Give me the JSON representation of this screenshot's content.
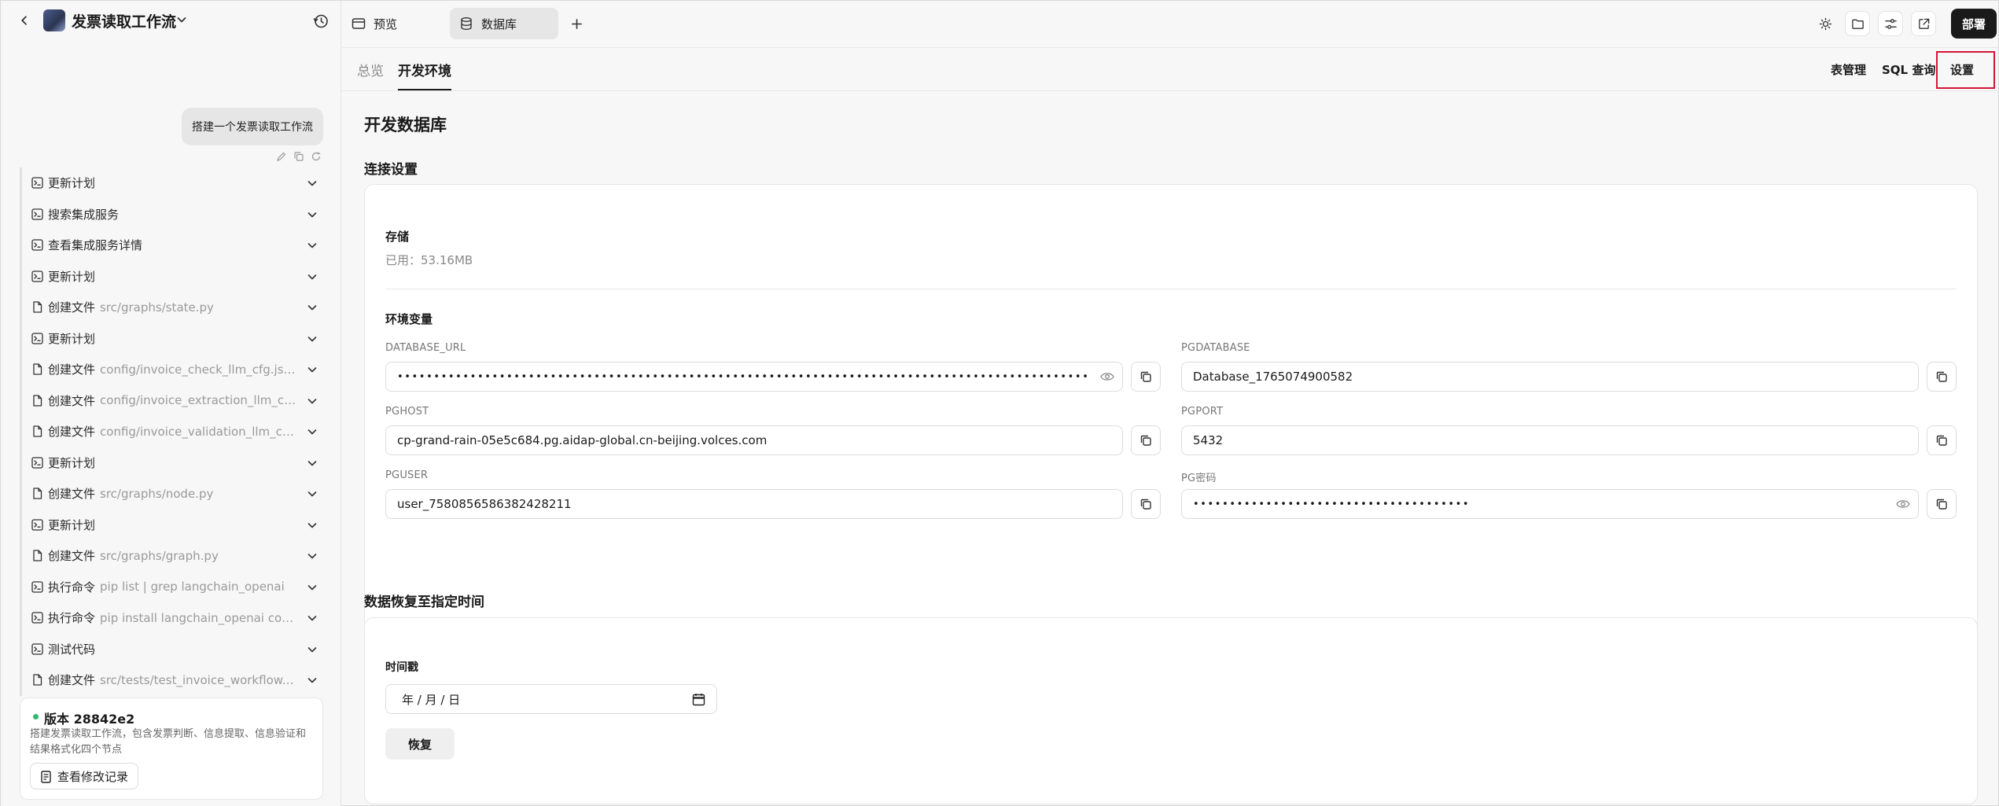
{
  "app": {
    "title": "发票读取工作流"
  },
  "chat": {
    "user_message": "搭建一个发票读取工作流",
    "steps": [
      {
        "label": "更新计划",
        "detail": "",
        "icon": "terminal-icon"
      },
      {
        "label": "搜索集成服务",
        "detail": "",
        "icon": "terminal-icon"
      },
      {
        "label": "查看集成服务详情",
        "detail": "",
        "icon": "terminal-icon"
      },
      {
        "label": "更新计划",
        "detail": "",
        "icon": "terminal-icon"
      },
      {
        "label": "创建文件",
        "detail": "src/graphs/state.py",
        "icon": "file-icon"
      },
      {
        "label": "更新计划",
        "detail": "",
        "icon": "terminal-icon"
      },
      {
        "label": "创建文件",
        "detail": "config/invoice_check_llm_cfg.json",
        "icon": "file-icon"
      },
      {
        "label": "创建文件",
        "detail": "config/invoice_extraction_llm_cf...",
        "icon": "file-icon"
      },
      {
        "label": "创建文件",
        "detail": "config/invoice_validation_llm_cfg...",
        "icon": "file-icon"
      },
      {
        "label": "更新计划",
        "detail": "",
        "icon": "terminal-icon"
      },
      {
        "label": "创建文件",
        "detail": "src/graphs/node.py",
        "icon": "file-icon"
      },
      {
        "label": "更新计划",
        "detail": "",
        "icon": "terminal-icon"
      },
      {
        "label": "创建文件",
        "detail": "src/graphs/graph.py",
        "icon": "file-icon"
      },
      {
        "label": "执行命令",
        "detail": "pip list | grep langchain_openai",
        "icon": "terminal-icon"
      },
      {
        "label": "执行命令",
        "detail": "pip install langchain_openai coze...",
        "icon": "terminal-icon"
      },
      {
        "label": "测试代码",
        "detail": "",
        "icon": "terminal-icon"
      },
      {
        "label": "创建文件",
        "detail": "src/tests/test_invoice_workflow.py",
        "icon": "file-icon"
      }
    ],
    "version": {
      "title": "版本 28842e2",
      "description": "搭建发票读取工作流，包含发票判断、信息提取、信息验证和结果格式化四个节点",
      "changes_button": "查看修改记录",
      "status_color": "#2eb871"
    }
  },
  "topbar": {
    "tabs": [
      {
        "label": "预览"
      },
      {
        "label": "数据库"
      }
    ],
    "deploy_label": "部署"
  },
  "subnav": {
    "tabs": [
      {
        "label": "总览"
      },
      {
        "label": "开发环境"
      }
    ],
    "table_mgmt": "表管理",
    "sql_query": "SQL 查询",
    "settings": "设置",
    "highlight_color": "#d6143a"
  },
  "main": {
    "title": "开发数据库",
    "connection": {
      "heading": "连接设置",
      "storage_title": "存储",
      "storage_used": "已用：53.16MB",
      "env_title": "环境变量",
      "vars": {
        "database_url": {
          "label": "DATABASE_URL",
          "value": "•••••••••••••••••••••••••••••••••••••••••••••••••••••••••••••••••••••••••••••••••••••••••••••••"
        },
        "pgdatabase": {
          "label": "PGDATABASE",
          "value": "Database_1765074900582"
        },
        "pghost": {
          "label": "PGHOST",
          "value": "cp-grand-rain-05e5c684.pg.aidap-global.cn-beijing.volces.com"
        },
        "pgport": {
          "label": "PGPORT",
          "value": "5432"
        },
        "pguser": {
          "label": "PGUSER",
          "value": "user_7580856586382428211"
        },
        "pgpassword": {
          "label": "PG密码",
          "value": "••••••••••••••••••••••••••••••••••••••"
        }
      }
    },
    "restore": {
      "heading": "数据恢复至指定时间",
      "timestamp_label": "时间戳",
      "date_placeholder": "年 / 月 / 日",
      "restore_button": "恢复"
    }
  }
}
